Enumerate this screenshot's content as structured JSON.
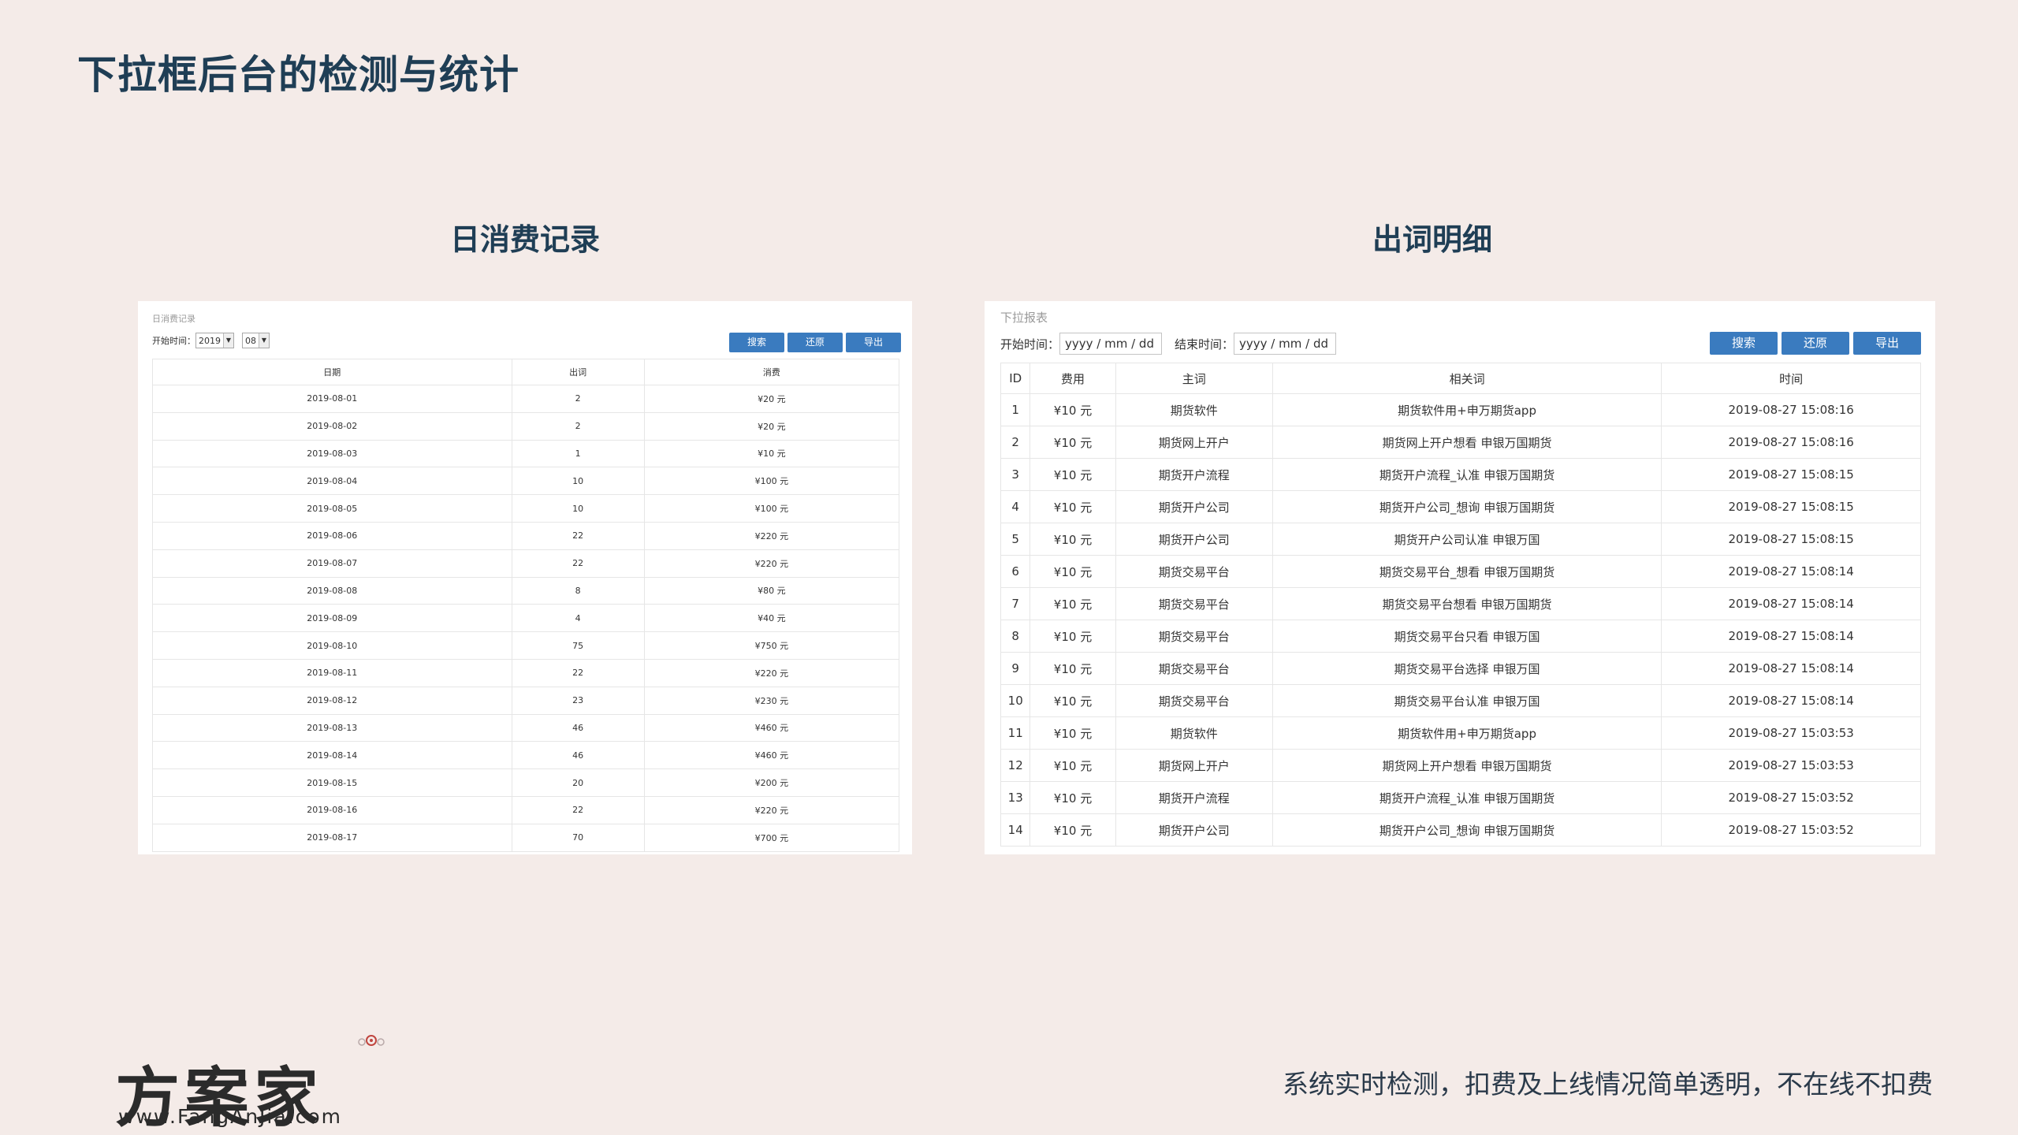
{
  "title": "下拉框后台的检测与统计",
  "left_section": {
    "heading": "日消费记录",
    "caption": "日消费记录",
    "filter_label": "开始时间：",
    "year_value": "2019",
    "month_value": "08",
    "buttons": [
      "搜索",
      "还原",
      "导出"
    ],
    "columns": [
      "日期",
      "出词",
      "消费"
    ],
    "rows": [
      [
        "2019-08-01",
        "2",
        "¥20 元"
      ],
      [
        "2019-08-02",
        "2",
        "¥20 元"
      ],
      [
        "2019-08-03",
        "1",
        "¥10 元"
      ],
      [
        "2019-08-04",
        "10",
        "¥100 元"
      ],
      [
        "2019-08-05",
        "10",
        "¥100 元"
      ],
      [
        "2019-08-06",
        "22",
        "¥220 元"
      ],
      [
        "2019-08-07",
        "22",
        "¥220 元"
      ],
      [
        "2019-08-08",
        "8",
        "¥80 元"
      ],
      [
        "2019-08-09",
        "4",
        "¥40 元"
      ],
      [
        "2019-08-10",
        "75",
        "¥750 元"
      ],
      [
        "2019-08-11",
        "22",
        "¥220 元"
      ],
      [
        "2019-08-12",
        "23",
        "¥230 元"
      ],
      [
        "2019-08-13",
        "46",
        "¥460 元"
      ],
      [
        "2019-08-14",
        "46",
        "¥460 元"
      ],
      [
        "2019-08-15",
        "20",
        "¥200 元"
      ],
      [
        "2019-08-16",
        "22",
        "¥220 元"
      ],
      [
        "2019-08-17",
        "70",
        "¥700 元"
      ]
    ]
  },
  "right_section": {
    "heading": "出词明细",
    "caption": "下拉报表",
    "start_label": "开始时间：",
    "start_placeholder": "yyyy / mm / dd",
    "end_label": "结束时间：",
    "end_placeholder": "yyyy / mm / dd",
    "buttons": [
      "搜索",
      "还原",
      "导出"
    ],
    "columns": [
      "ID",
      "费用",
      "主词",
      "相关词",
      "时间"
    ],
    "rows": [
      [
        "1",
        "¥10 元",
        "期货软件",
        "期货软件用+申万期货app",
        "2019-08-27 15:08:16"
      ],
      [
        "2",
        "¥10 元",
        "期货网上开户",
        "期货网上开户想看 申银万国期货",
        "2019-08-27 15:08:16"
      ],
      [
        "3",
        "¥10 元",
        "期货开户流程",
        "期货开户流程_认准 申银万国期货",
        "2019-08-27 15:08:15"
      ],
      [
        "4",
        "¥10 元",
        "期货开户公司",
        "期货开户公司_想询 申银万国期货",
        "2019-08-27 15:08:15"
      ],
      [
        "5",
        "¥10 元",
        "期货开户公司",
        "期货开户公司认准 申银万国",
        "2019-08-27 15:08:15"
      ],
      [
        "6",
        "¥10 元",
        "期货交易平台",
        "期货交易平台_想看 申银万国期货",
        "2019-08-27 15:08:14"
      ],
      [
        "7",
        "¥10 元",
        "期货交易平台",
        "期货交易平台想看 申银万国期货",
        "2019-08-27 15:08:14"
      ],
      [
        "8",
        "¥10 元",
        "期货交易平台",
        "期货交易平台只看 申银万国",
        "2019-08-27 15:08:14"
      ],
      [
        "9",
        "¥10 元",
        "期货交易平台",
        "期货交易平台选择 申银万国",
        "2019-08-27 15:08:14"
      ],
      [
        "10",
        "¥10 元",
        "期货交易平台",
        "期货交易平台认准 申银万国",
        "2019-08-27 15:08:14"
      ],
      [
        "11",
        "¥10 元",
        "期货软件",
        "期货软件用+申万期货app",
        "2019-08-27 15:03:53"
      ],
      [
        "12",
        "¥10 元",
        "期货网上开户",
        "期货网上开户想看 申银万国期货",
        "2019-08-27 15:03:53"
      ],
      [
        "13",
        "¥10 元",
        "期货开户流程",
        "期货开户流程_认准 申银万国期货",
        "2019-08-27 15:03:52"
      ],
      [
        "14",
        "¥10 元",
        "期货开户公司",
        "期货开户公司_想询 申银万国期货",
        "2019-08-27 15:03:52"
      ]
    ]
  },
  "logo": {
    "name": "方案家",
    "url": "www.FangAnJia.com"
  },
  "footer": "系统实时检测，扣费及上线情况简单透明，不在线不扣费"
}
